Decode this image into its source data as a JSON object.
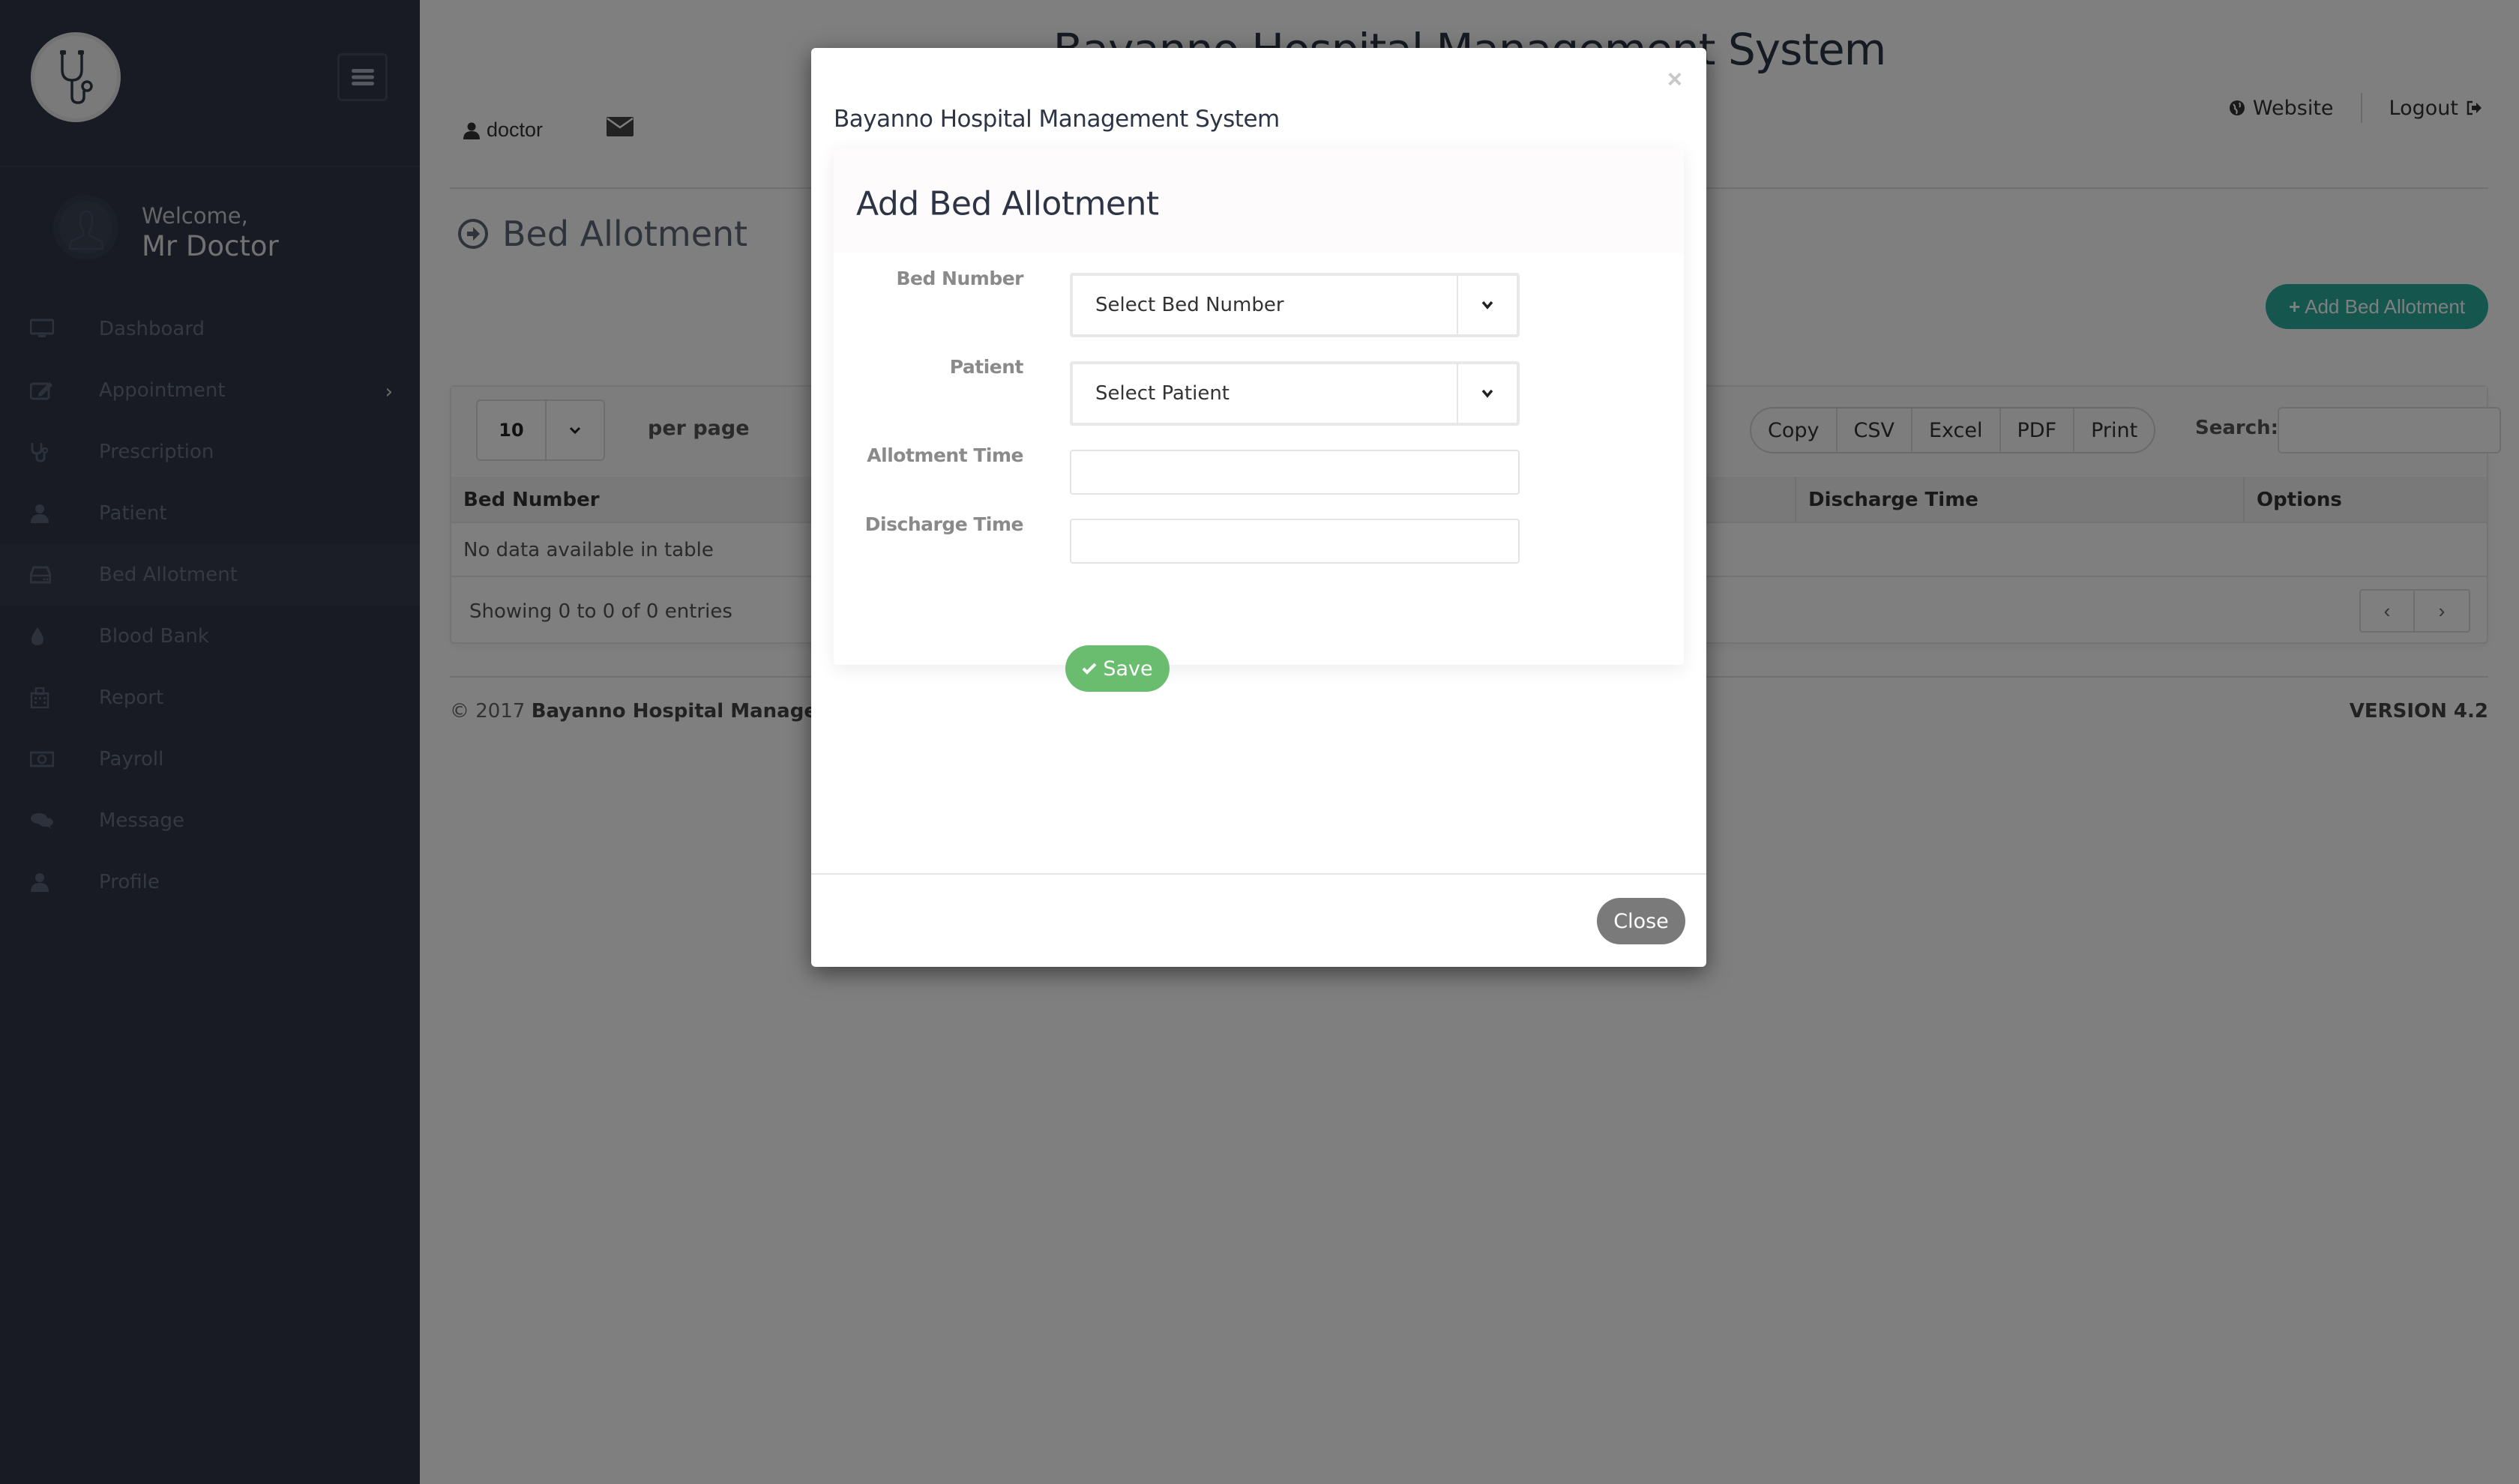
{
  "app": {
    "title": "Bayanno Hospital Management System"
  },
  "sidebar": {
    "welcome": "Welcome,",
    "user_name": "Mr Doctor",
    "items": [
      {
        "label": "Dashboard",
        "icon": "desktop-icon"
      },
      {
        "label": "Appointment",
        "icon": "edit-icon",
        "has_submenu": true
      },
      {
        "label": "Prescription",
        "icon": "stethoscope-icon"
      },
      {
        "label": "Patient",
        "icon": "user-icon"
      },
      {
        "label": "Bed Allotment",
        "icon": "bed-icon",
        "active": true
      },
      {
        "label": "Blood Bank",
        "icon": "tint-icon"
      },
      {
        "label": "Report",
        "icon": "hospital-icon"
      },
      {
        "label": "Payroll",
        "icon": "money-icon"
      },
      {
        "label": "Message",
        "icon": "comments-icon"
      },
      {
        "label": "Profile",
        "icon": "user-icon"
      }
    ]
  },
  "header": {
    "user": "doctor",
    "website": "Website",
    "logout": "Logout"
  },
  "page": {
    "title": "Bed Allotment",
    "add_button": "Add Bed Allotment",
    "add_button_color": "#2aaf9f"
  },
  "table": {
    "per_page_value": "10",
    "per_page_label": "per page",
    "export_buttons": [
      "Copy",
      "CSV",
      "Excel",
      "PDF",
      "Print"
    ],
    "search_label": "Search:",
    "search_value": "",
    "columns": [
      "Bed Number",
      "Discharge Time",
      "Options"
    ],
    "empty_message": "No data available in table",
    "info": "Showing 0 to 0 of 0 entries",
    "pager_prev": "‹",
    "pager_next": "›"
  },
  "footer": {
    "copyright_prefix": "© 2017",
    "copyright_name": "Bayanno Hospital Management S",
    "version": "VERSION 4.2"
  },
  "modal": {
    "title": "Bayanno Hospital Management System",
    "close_x": "×",
    "form_title": "Add Bed Allotment",
    "fields": {
      "bed_number": {
        "label": "Bed Number",
        "value": "Select Bed Number"
      },
      "patient": {
        "label": "Patient",
        "value": "Select Patient"
      },
      "allotment_time": {
        "label": "Allotment Time",
        "value": ""
      },
      "discharge_time": {
        "label": "Discharge Time",
        "value": ""
      }
    },
    "save_label": "Save",
    "save_color": "#6abd6e",
    "close_label": "Close"
  }
}
